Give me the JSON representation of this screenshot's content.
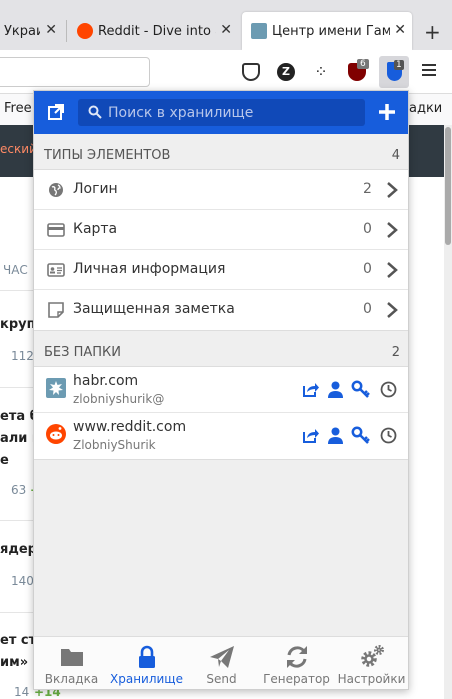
{
  "browser": {
    "tabs": [
      {
        "title": "Украи"
      },
      {
        "title": "Reddit - Dive into a"
      },
      {
        "title": "Центр имени Гам"
      }
    ],
    "bookmarks": {
      "left": "Free",
      "right": "адки"
    },
    "extensions": {
      "z_label": "Z",
      "ublock_badge": "6",
      "bitwarden_badge": "1"
    }
  },
  "background_page": {
    "red_text": "еский",
    "col_header": "ЧАС",
    "lines": [
      "крупт",
      "112",
      "ета бл",
      "али п",
      "е",
      "63",
      "+",
      "ядерн",
      "140",
      "ет ст",
      "им» и",
      "14",
      "+14"
    ]
  },
  "popup": {
    "search_placeholder": "Поиск в хранилище",
    "types_header": "ТИПЫ ЭЛЕМЕНТОВ",
    "types_count": "4",
    "types": [
      {
        "label": "Логин",
        "count": "2",
        "icon": "globe-icon"
      },
      {
        "label": "Карта",
        "count": "0",
        "icon": "credit-card-icon"
      },
      {
        "label": "Личная информация",
        "count": "0",
        "icon": "id-card-icon"
      },
      {
        "label": "Защищенная заметка",
        "count": "0",
        "icon": "note-icon"
      }
    ],
    "nofolder_header": "БЕЗ ПАПКИ",
    "nofolder_count": "2",
    "items": [
      {
        "name": "habr.com",
        "username": "zlobniyshurik@",
        "icon": "habr-favicon"
      },
      {
        "name": "www.reddit.com",
        "username": "ZlobniyShurik",
        "icon": "reddit-favicon"
      }
    ],
    "nav": [
      {
        "label": "Вкладка",
        "icon": "folder-icon",
        "active": false
      },
      {
        "label": "Хранилище",
        "icon": "lock-icon",
        "active": true
      },
      {
        "label": "Send",
        "icon": "paper-plane-icon",
        "active": false
      },
      {
        "label": "Генератор",
        "icon": "refresh-icon",
        "active": false
      },
      {
        "label": "Настройки",
        "icon": "gears-icon",
        "active": false
      }
    ],
    "colors": {
      "accent": "#175ddc",
      "icon": "#777777",
      "chevron": "#555555"
    }
  }
}
